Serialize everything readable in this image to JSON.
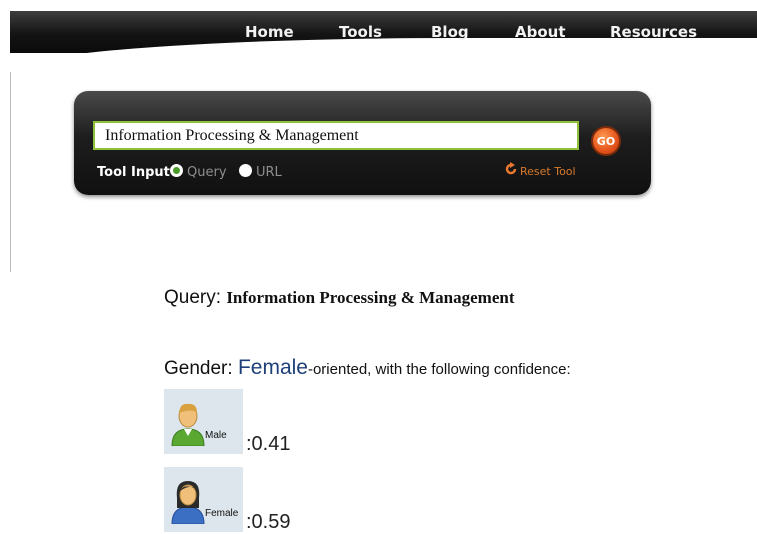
{
  "nav": {
    "items": [
      "Home",
      "Tools",
      "Blog",
      "About",
      "Resources"
    ]
  },
  "tool": {
    "input_value": "Information Processing & Management",
    "go_label": "GO",
    "input_label": "Tool Input",
    "options": [
      "Query",
      "URL"
    ],
    "selected_option": "Query",
    "reset_label": "Reset Tool"
  },
  "result": {
    "query_label": "Query:",
    "query_value": "Information Processing & Management",
    "gender_label": "Gender:",
    "gender_value": "Female",
    "gender_rest": "-oriented, with the following confidence:",
    "male": {
      "label": "Male",
      "score": ":0.41"
    },
    "female": {
      "label": "Female",
      "score": ":0.59"
    }
  },
  "colors": {
    "accent_orange": "#e4531a",
    "input_border": "#8fc23a",
    "gender_value": "#1f3f7a"
  }
}
